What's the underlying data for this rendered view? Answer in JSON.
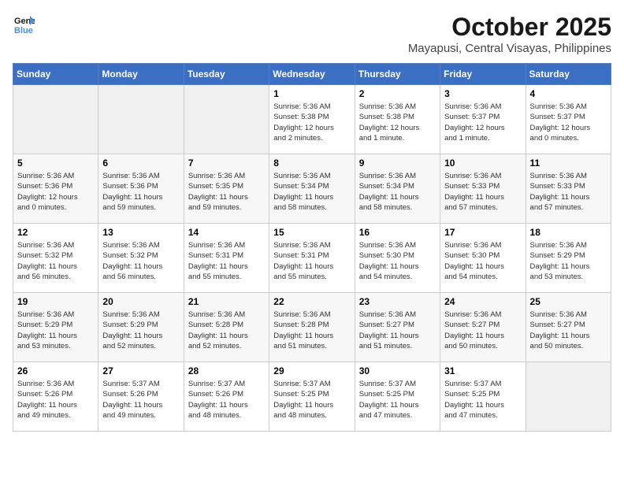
{
  "logo": {
    "line1": "General",
    "line2": "Blue"
  },
  "title": "October 2025",
  "location": "Mayapusi, Central Visayas, Philippines",
  "weekdays": [
    "Sunday",
    "Monday",
    "Tuesday",
    "Wednesday",
    "Thursday",
    "Friday",
    "Saturday"
  ],
  "weeks": [
    [
      {
        "day": "",
        "info": ""
      },
      {
        "day": "",
        "info": ""
      },
      {
        "day": "",
        "info": ""
      },
      {
        "day": "1",
        "info": "Sunrise: 5:36 AM\nSunset: 5:38 PM\nDaylight: 12 hours\nand 2 minutes."
      },
      {
        "day": "2",
        "info": "Sunrise: 5:36 AM\nSunset: 5:38 PM\nDaylight: 12 hours\nand 1 minute."
      },
      {
        "day": "3",
        "info": "Sunrise: 5:36 AM\nSunset: 5:37 PM\nDaylight: 12 hours\nand 1 minute."
      },
      {
        "day": "4",
        "info": "Sunrise: 5:36 AM\nSunset: 5:37 PM\nDaylight: 12 hours\nand 0 minutes."
      }
    ],
    [
      {
        "day": "5",
        "info": "Sunrise: 5:36 AM\nSunset: 5:36 PM\nDaylight: 12 hours\nand 0 minutes."
      },
      {
        "day": "6",
        "info": "Sunrise: 5:36 AM\nSunset: 5:36 PM\nDaylight: 11 hours\nand 59 minutes."
      },
      {
        "day": "7",
        "info": "Sunrise: 5:36 AM\nSunset: 5:35 PM\nDaylight: 11 hours\nand 59 minutes."
      },
      {
        "day": "8",
        "info": "Sunrise: 5:36 AM\nSunset: 5:34 PM\nDaylight: 11 hours\nand 58 minutes."
      },
      {
        "day": "9",
        "info": "Sunrise: 5:36 AM\nSunset: 5:34 PM\nDaylight: 11 hours\nand 58 minutes."
      },
      {
        "day": "10",
        "info": "Sunrise: 5:36 AM\nSunset: 5:33 PM\nDaylight: 11 hours\nand 57 minutes."
      },
      {
        "day": "11",
        "info": "Sunrise: 5:36 AM\nSunset: 5:33 PM\nDaylight: 11 hours\nand 57 minutes."
      }
    ],
    [
      {
        "day": "12",
        "info": "Sunrise: 5:36 AM\nSunset: 5:32 PM\nDaylight: 11 hours\nand 56 minutes."
      },
      {
        "day": "13",
        "info": "Sunrise: 5:36 AM\nSunset: 5:32 PM\nDaylight: 11 hours\nand 56 minutes."
      },
      {
        "day": "14",
        "info": "Sunrise: 5:36 AM\nSunset: 5:31 PM\nDaylight: 11 hours\nand 55 minutes."
      },
      {
        "day": "15",
        "info": "Sunrise: 5:36 AM\nSunset: 5:31 PM\nDaylight: 11 hours\nand 55 minutes."
      },
      {
        "day": "16",
        "info": "Sunrise: 5:36 AM\nSunset: 5:30 PM\nDaylight: 11 hours\nand 54 minutes."
      },
      {
        "day": "17",
        "info": "Sunrise: 5:36 AM\nSunset: 5:30 PM\nDaylight: 11 hours\nand 54 minutes."
      },
      {
        "day": "18",
        "info": "Sunrise: 5:36 AM\nSunset: 5:29 PM\nDaylight: 11 hours\nand 53 minutes."
      }
    ],
    [
      {
        "day": "19",
        "info": "Sunrise: 5:36 AM\nSunset: 5:29 PM\nDaylight: 11 hours\nand 53 minutes."
      },
      {
        "day": "20",
        "info": "Sunrise: 5:36 AM\nSunset: 5:29 PM\nDaylight: 11 hours\nand 52 minutes."
      },
      {
        "day": "21",
        "info": "Sunrise: 5:36 AM\nSunset: 5:28 PM\nDaylight: 11 hours\nand 52 minutes."
      },
      {
        "day": "22",
        "info": "Sunrise: 5:36 AM\nSunset: 5:28 PM\nDaylight: 11 hours\nand 51 minutes."
      },
      {
        "day": "23",
        "info": "Sunrise: 5:36 AM\nSunset: 5:27 PM\nDaylight: 11 hours\nand 51 minutes."
      },
      {
        "day": "24",
        "info": "Sunrise: 5:36 AM\nSunset: 5:27 PM\nDaylight: 11 hours\nand 50 minutes."
      },
      {
        "day": "25",
        "info": "Sunrise: 5:36 AM\nSunset: 5:27 PM\nDaylight: 11 hours\nand 50 minutes."
      }
    ],
    [
      {
        "day": "26",
        "info": "Sunrise: 5:36 AM\nSunset: 5:26 PM\nDaylight: 11 hours\nand 49 minutes."
      },
      {
        "day": "27",
        "info": "Sunrise: 5:37 AM\nSunset: 5:26 PM\nDaylight: 11 hours\nand 49 minutes."
      },
      {
        "day": "28",
        "info": "Sunrise: 5:37 AM\nSunset: 5:26 PM\nDaylight: 11 hours\nand 48 minutes."
      },
      {
        "day": "29",
        "info": "Sunrise: 5:37 AM\nSunset: 5:25 PM\nDaylight: 11 hours\nand 48 minutes."
      },
      {
        "day": "30",
        "info": "Sunrise: 5:37 AM\nSunset: 5:25 PM\nDaylight: 11 hours\nand 47 minutes."
      },
      {
        "day": "31",
        "info": "Sunrise: 5:37 AM\nSunset: 5:25 PM\nDaylight: 11 hours\nand 47 minutes."
      },
      {
        "day": "",
        "info": ""
      }
    ]
  ]
}
